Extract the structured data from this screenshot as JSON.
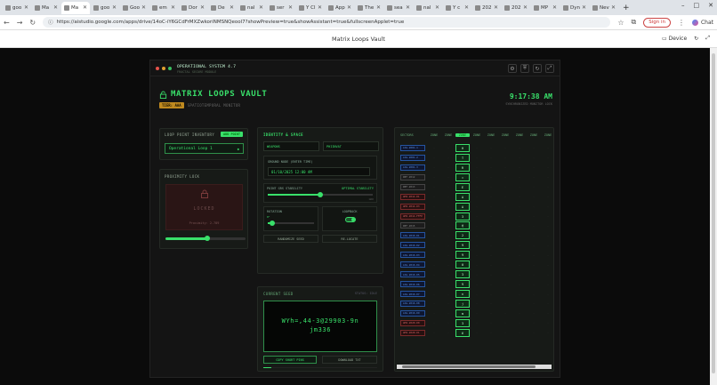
{
  "browser": {
    "tabs": [
      {
        "label": "goo"
      },
      {
        "label": "Ma"
      },
      {
        "label": "Ma",
        "active": true
      },
      {
        "label": "goo"
      },
      {
        "label": "Goo"
      },
      {
        "label": "em"
      },
      {
        "label": "Dor"
      },
      {
        "label": "De"
      },
      {
        "label": "nal"
      },
      {
        "label": "ser"
      },
      {
        "label": "Y Cl"
      },
      {
        "label": "App"
      },
      {
        "label": "The"
      },
      {
        "label": "sea"
      },
      {
        "label": "nal"
      },
      {
        "label": "Y c"
      },
      {
        "label": "202"
      },
      {
        "label": "202"
      },
      {
        "label": "MP"
      },
      {
        "label": "Dyn"
      },
      {
        "label": "Nev"
      }
    ],
    "new_tab": "+",
    "url": "https://aistudio.google.com/apps/drive/14oC-iY6GCdFrMXZwkoriNMSNQeool7?showPreview=true&showAssistant=true&fullscreenApplet=true",
    "sign_in": "Sign in",
    "chat_label": "Chat"
  },
  "app_header": {
    "title": "Matrix Loops Vault",
    "device_label": "Device"
  },
  "frame": {
    "system_line": "OPERATIONAL SYSTEM 4.7",
    "system_sub": "FRACTAL SECURE MODULE",
    "title": "MATRIX LOOPS VAULT",
    "tier": "TIER: AAA",
    "subtitle": "SPATIOTEMPORAL MONITOR",
    "clock": "9:17:38 AM",
    "clock_sub": "SYNCHRONIZED MONITOR LOCK"
  },
  "inventory": {
    "header": "LOOP POINT INVENTORY",
    "add_button": "ADD POINT",
    "selected": "Operational Loop 1"
  },
  "proximity": {
    "header": "PROXIMITY LOCK",
    "state": "LOCKED",
    "readout": "Proximity: 2.789",
    "slider_value": 0.52
  },
  "identity": {
    "header": "IDENTITY & SPACE",
    "field_a": "WEAPONS",
    "field_b": "PHIINVAT",
    "anchor_label": "GROUND NODE (ENTER TIME)",
    "anchor_value": "01/10/2025 12:00 AM",
    "stability_label": "POINT GRS STABILITY",
    "stability_right": "OPTIMAL STABILITY",
    "stability_value": 0.5,
    "stability_hint": "GRD",
    "rotation_label": "ROTATION",
    "rotation_value_text": "0°",
    "rotation_value": 0.1,
    "loopback_label": "LOOPBACK",
    "btn_random": "RANDOMIZE SEED",
    "btn_locate": "RE-LOCATE"
  },
  "output": {
    "header": "CURRENT SEED",
    "header_right": "STATUS: IDLE",
    "text": "WYh=,44-3@29903-9n jm336",
    "copy": "COPY SHORT PINS",
    "download": "DOWNLOAD TXT",
    "progress": 0.07
  },
  "grid": {
    "columns": [
      "SECTORS",
      "ZONE",
      "ZONE",
      "ZONE",
      "ZONE",
      "ZONE",
      "ZONE",
      "ZONE",
      "ZONE",
      "ZONE"
    ],
    "highlight_column": 3,
    "rows": [
      {
        "tag": "LOG-2001-1",
        "color": "blue",
        "value": "H"
      },
      {
        "tag": "LOG-2001-2",
        "color": "blue",
        "value": "T"
      },
      {
        "tag": "LOG-2001-3",
        "color": "blue",
        "value": "R"
      },
      {
        "tag": "REF-2012",
        "color": "gray",
        "value": "="
      },
      {
        "tag": "REF-2013",
        "color": "gray",
        "value": "E"
      },
      {
        "tag": "AMX-2014-01",
        "color": "red",
        "value": "A"
      },
      {
        "tag": "AMX-2014-03",
        "color": "red",
        "value": "A"
      },
      {
        "tag": "AMX-2014-FFFE",
        "color": "red",
        "value": "3"
      },
      {
        "tag": "REF-2015",
        "color": "gray",
        "value": "@"
      },
      {
        "tag": "LOG-2016-01",
        "color": "blue",
        "value": "2"
      },
      {
        "tag": "LOG-2016-02",
        "color": "blue",
        "value": "9"
      },
      {
        "tag": "LOG-2016-03",
        "color": "blue",
        "value": "9"
      },
      {
        "tag": "LOG-2016-04",
        "color": "blue",
        "value": "0"
      },
      {
        "tag": "LOG-2016-05",
        "color": "blue",
        "value": "3"
      },
      {
        "tag": "LOG-2016-06",
        "color": "blue",
        "value": "9"
      },
      {
        "tag": "LOG-2016-07",
        "color": "blue",
        "value": "n"
      },
      {
        "tag": "LOG-2016-08",
        "color": "blue",
        "value": "j"
      },
      {
        "tag": "LOG-2016-09",
        "color": "blue",
        "value": "m"
      },
      {
        "tag": "AMX-2020-00",
        "color": "red",
        "value": "3"
      },
      {
        "tag": "AMX-2020-01",
        "color": "red",
        "value": "6"
      }
    ]
  },
  "colors": {
    "accent": "#39e06a",
    "warning": "#c08a1f",
    "locked_bg": "#2a1515"
  }
}
